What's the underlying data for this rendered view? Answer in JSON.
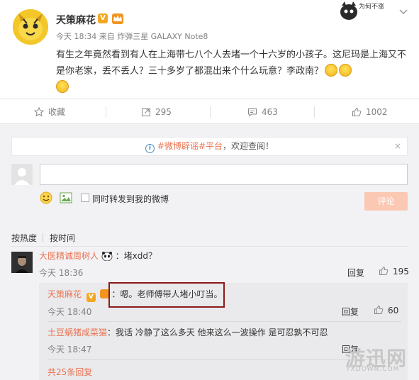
{
  "post": {
    "author": "天策麻花",
    "vip_badge": "V",
    "meta": "今天 18:34 来自 炸弹三星 GALAXY Note8",
    "text": "有生之年竟然看到有人在上海带七八个人去堵一个十六岁的小孩子。这尼玛是上海又不是你老家，丢不丢人？三十多岁了都混出来个什么玩意？李政南？"
  },
  "actions": {
    "favorite": "收藏",
    "share_count": "295",
    "comment_count": "463",
    "like_count": "1002"
  },
  "notice": {
    "link": "#微博辟谣#平台",
    "text": "，欢迎查阅！",
    "close": "×"
  },
  "composer": {
    "forward_label": "同时转发到我的微博",
    "submit_label": "评论"
  },
  "sort": {
    "hot": "按热度",
    "time": "按时间"
  },
  "comments": [
    {
      "user": "大医精诚周树人",
      "text": "：堵xdd？",
      "time": "今天 18:36",
      "reply": "回复",
      "likes": "195"
    }
  ],
  "replies": [
    {
      "user": "天策麻花",
      "text": "：嗯。老师傅带人堵小叮当。",
      "time": "今天 18:40",
      "reply": "回复",
      "likes": "60"
    },
    {
      "user": "土豆蜗猪咸菜猫",
      "text": "：我话 冷静了这么多天 他来这么一波操作 是可忍孰不可忍",
      "time": "今天 18:47",
      "reply": "回复"
    }
  ],
  "more_replies": "共25条回复",
  "watermark": {
    "main": "游迅网",
    "sub": "YXDOWN.COM",
    "top": "为何不涨"
  },
  "colors": {
    "link": "#eb7350",
    "submit_disabled": "#fbc8b4",
    "highlight_border": "#8b1a1a"
  }
}
